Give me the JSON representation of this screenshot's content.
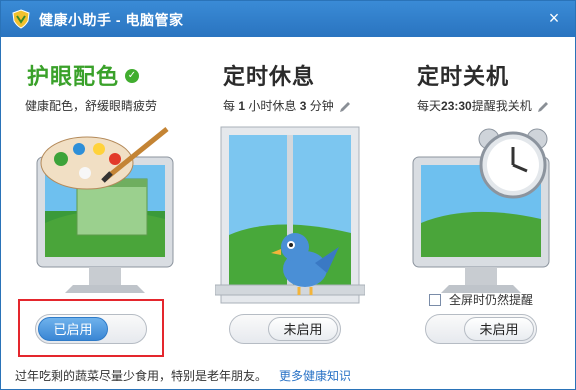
{
  "window": {
    "title": "健康小助手 - 电脑管家",
    "close_symbol": "×"
  },
  "features": [
    {
      "title": "护眼配色",
      "desc": "健康配色，舒缓眼睛疲劳",
      "toggle": "已启用",
      "enabled": true,
      "image": "palette-monitor"
    },
    {
      "title": "定时休息",
      "desc_parts": [
        "每 ",
        "1",
        " 小时休息 ",
        "3",
        " 分钟"
      ],
      "toggle": "未启用",
      "enabled": false,
      "image": "window-bird"
    },
    {
      "title": "定时关机",
      "desc_parts": [
        "每天",
        "23:30",
        "提醒我关机"
      ],
      "toggle": "未启用",
      "enabled": false,
      "image": "clock-monitor"
    }
  ],
  "fullscreen_option": "全屏时仍然提醒",
  "footer": {
    "tip": "过年吃剩的蔬菜尽量少食用，特别是老年朋友。",
    "link": "更多健康知识"
  },
  "colors": {
    "titlebar": "#2f7dc9",
    "accent_green": "#3aa12a",
    "highlight_red": "#e4262d",
    "toggle_on": "#3a86d4"
  }
}
